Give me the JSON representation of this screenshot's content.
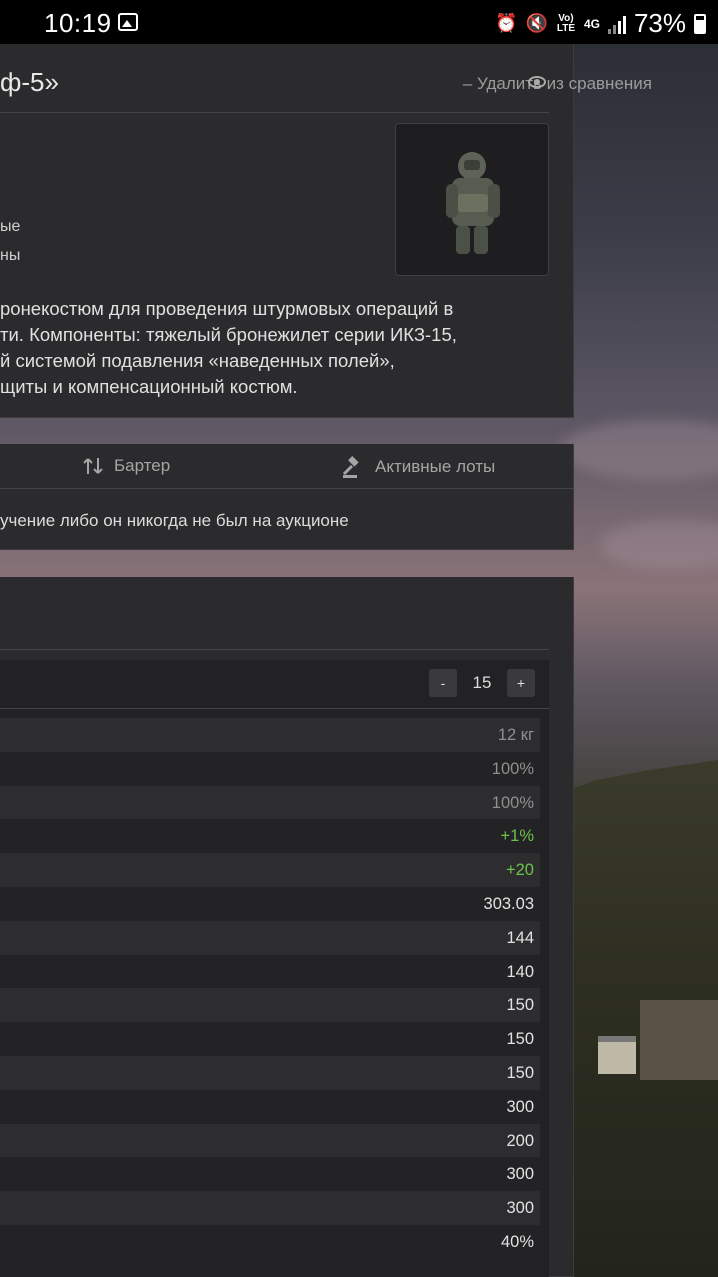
{
  "status_bar": {
    "time": "10:19",
    "battery": "73%",
    "net": "4G",
    "volte": "Vo) LTE"
  },
  "item": {
    "title_fragment": "ф-5»",
    "remove_label": "– Удалить из сравнения",
    "attr_fragments": [
      "ые",
      "ны"
    ],
    "description_lines": [
      "ронекостюм для проведения штурмовых операций в",
      "ти. Компоненты: тяжелый бронежилет серии ИКЗ-15,",
      "й системой подавления «наведенных полей»,",
      "щиты и компенсационный костюм."
    ]
  },
  "tabs": {
    "barter": "Бартер",
    "lots": "Активные лоты"
  },
  "notice": "учение либо он никогда не был на аукционе",
  "stats": {
    "level_value": "15",
    "minus_label": "-",
    "plus_label": "+",
    "rows": [
      {
        "value": "12 кг",
        "style": "muted"
      },
      {
        "value": "100%",
        "style": "muted"
      },
      {
        "value": "100%",
        "style": "muted"
      },
      {
        "value": "+1%",
        "style": "green"
      },
      {
        "value": "+20",
        "style": "green"
      },
      {
        "value": "303.03",
        "style": "normal"
      },
      {
        "value": "144",
        "style": "normal"
      },
      {
        "value": "140",
        "style": "normal"
      },
      {
        "value": "150",
        "style": "normal"
      },
      {
        "value": "150",
        "style": "normal"
      },
      {
        "value": "150",
        "style": "normal"
      },
      {
        "value": "300",
        "style": "normal"
      },
      {
        "value": "200",
        "style": "normal"
      },
      {
        "value": "300",
        "style": "normal"
      },
      {
        "value": "300",
        "style": "normal"
      },
      {
        "value": "40%",
        "style": "normal"
      }
    ]
  }
}
